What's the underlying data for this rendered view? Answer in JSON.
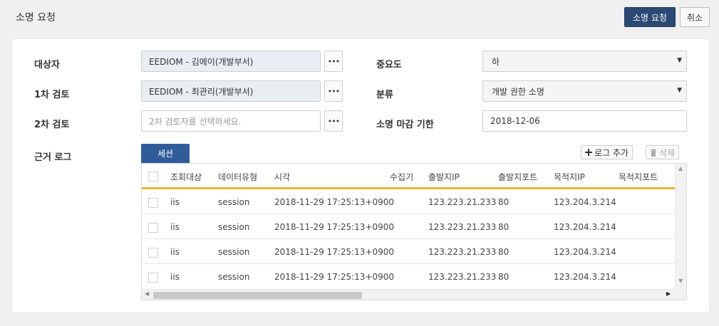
{
  "header": {
    "title": "소명 요청",
    "submit_label": "소명 요청",
    "cancel_label": "취소"
  },
  "form": {
    "target_label": "대상자",
    "target_value": "EEDIOM - 김에이(개발부서)",
    "review1_label": "1차 검토",
    "review1_value": "EEDIOM - 최관리(개발부서)",
    "review2_label": "2차 검토",
    "review2_placeholder": "2차 검토자를 선택하세요.",
    "priority_label": "중요도",
    "priority_value": "하",
    "category_label": "분류",
    "category_value": "개발 권한 소명",
    "deadline_label": "소명 마감 기한",
    "deadline_value": "2018-12-06",
    "evidence_label": "근거 로그",
    "dots": "•••"
  },
  "log": {
    "tab_label": "세션",
    "add_label": "로그 추가",
    "delete_label": "삭제",
    "columns": [
      "조회대상",
      "데이터유형",
      "시각",
      "수집기",
      "출발지IP",
      "출발지포트",
      "목적지IP",
      "목적지포트"
    ],
    "rows": [
      [
        "iis",
        "session",
        "2018-11-29 17:25:13+0900",
        "",
        "123.223.21.233",
        "80",
        "123.204.3.214",
        ""
      ],
      [
        "iis",
        "session",
        "2018-11-29 17:25:13+0900",
        "",
        "123.223.21.233",
        "80",
        "123.204.3.214",
        ""
      ],
      [
        "iis",
        "session",
        "2018-11-29 17:25:13+0900",
        "",
        "123.223.21.233",
        "80",
        "123.204.3.214",
        ""
      ],
      [
        "iis",
        "session",
        "2018-11-29 17:25:13+0900",
        "",
        "123.223.21.233",
        "80",
        "123.204.3.214",
        ""
      ]
    ]
  },
  "icons": {
    "plus": "plus-icon",
    "trash": "trash-icon",
    "dropdown": "chevron-down-icon"
  },
  "colors": {
    "primary": "#2b4a73",
    "tab": "#2f5d9a",
    "header_accent": "#f0b429"
  }
}
